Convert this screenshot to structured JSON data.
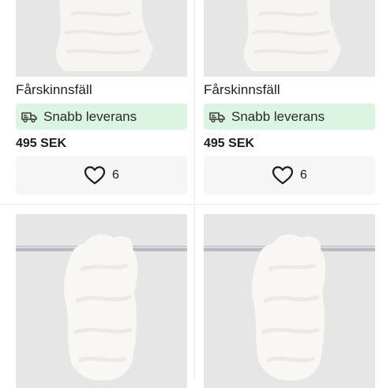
{
  "products": [
    {
      "title": "Fårskinnsfäll",
      "badge": "Snabb leverans",
      "price": "495 SEK",
      "likes": "6"
    },
    {
      "title": "Fårskinnsfäll",
      "badge": "Snabb leverans",
      "price": "495 SEK",
      "likes": "6"
    }
  ],
  "icons": {
    "badge": "truck-icon",
    "favorite": "heart-icon"
  },
  "colors": {
    "badge_bg": "#dcf5e3",
    "fav_bg": "#f6f6f6",
    "image_bg": "#e6e6e6"
  }
}
